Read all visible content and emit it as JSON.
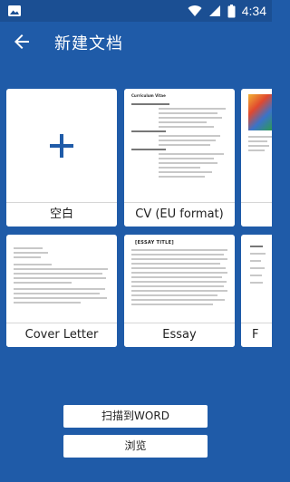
{
  "status_bar": {
    "time": "4:34"
  },
  "app_bar": {
    "title": "新建文档",
    "back_icon": "back-arrow-icon"
  },
  "templates": [
    {
      "label": "空白",
      "kind": "blank"
    },
    {
      "label": "CV (EU format)",
      "kind": "cv"
    },
    {
      "label": "",
      "kind": "photo-doc"
    },
    {
      "label": "Cover Letter",
      "kind": "letter"
    },
    {
      "label": "Essay",
      "kind": "essay",
      "header_text": "[ESSAY TITLE]"
    },
    {
      "label": "F",
      "kind": "form"
    }
  ],
  "cv_preview": {
    "heading": "Curriculum Vitae"
  },
  "buttons": {
    "scan_label": "扫描到WORD",
    "browse_label": "浏览"
  },
  "colors": {
    "background": "#1f5ba8",
    "status_bar": "#1b4f93",
    "accent": "#1f5ba8"
  }
}
